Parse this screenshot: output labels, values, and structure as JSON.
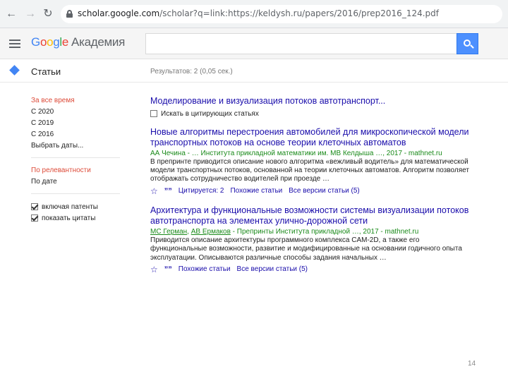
{
  "browser": {
    "url_host": "scholar.google.com",
    "url_path": "/scholar?q=link:https://keldysh.ru/papers/2016/prep2016_124.pdf"
  },
  "header": {
    "logo_letters": [
      "G",
      "o",
      "o",
      "g",
      "l",
      "e"
    ],
    "product": "Академия",
    "search_value": ""
  },
  "subbar": {
    "articles": "Статьи",
    "results_count": "Результатов: 2 (0,05 сек.)"
  },
  "sidebar": {
    "time_filters": [
      "За все время",
      "С 2020",
      "С 2019",
      "С 2016",
      "Выбрать даты..."
    ],
    "sort_options": [
      "По релевантности",
      "По дате"
    ],
    "checks": [
      {
        "label": "включая патенты",
        "checked": true
      },
      {
        "label": "показать цитаты",
        "checked": true
      }
    ]
  },
  "query_article": {
    "title": "Моделирование и визуализация потоков автотранспорт...",
    "search_citing": "Искать в цитирующих статьях"
  },
  "results": [
    {
      "title": "Новые алгоритмы перестроения автомобилей для микроскопической модели транспортных потоков на основе теории клеточных автоматов",
      "authors_prefix": "",
      "author_links": [],
      "authors_rest": "АА Чечина - … Институтa прикладной математики им. МВ Келдыша …, 2017 - mathnet.ru",
      "snippet": "В препринте приводится описание нового алгоритма «вежливый водитель» для математической модели транспортных потоков, основанной на теории клеточных автоматов. Алгоритм позволяет отображать сотрудничество водителей при проезде …",
      "actions": [
        "Цитируется: 2",
        "Похожие статьи",
        "Все версии статьи (5)"
      ]
    },
    {
      "title": "Архитектура и функциональные возможности системы визуализации потоков автотранспорта на элементах улично-дорожной сети",
      "authors_prefix": "",
      "author_links": [
        "МС Герман",
        "АВ Ермаков"
      ],
      "authors_rest": " - Препринты Института прикладной …, 2017 - mathnet.ru",
      "snippet": "Приводится описание архитектуры программного комплекса CAM-2D, а также его функциональные возможности, развитие и модифицированные на основании годичного опыта эксплуатации. Описываются различные способы задания начальных …",
      "actions": [
        "Похожие статьи",
        "Все версии статьи (5)"
      ]
    }
  ],
  "page_number": "14"
}
